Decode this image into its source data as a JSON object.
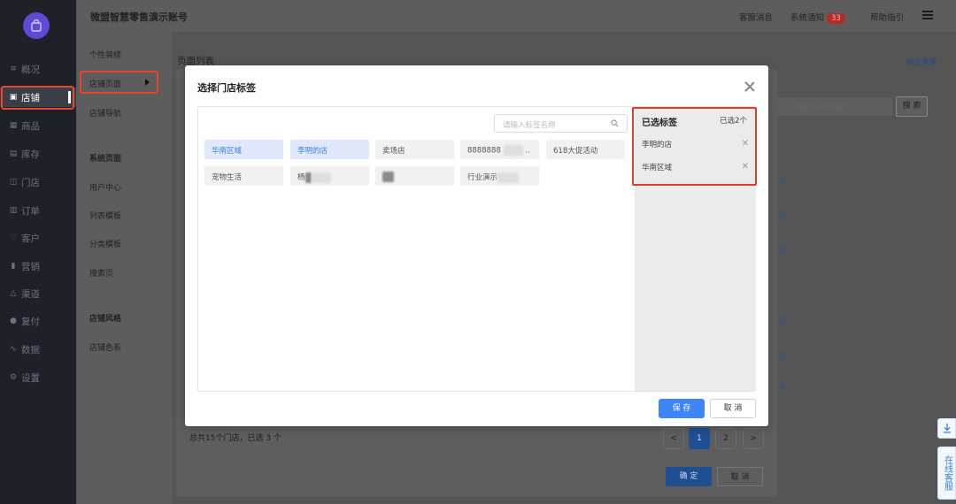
{
  "header": {
    "title": "微盟智慧零售演示账号",
    "links": [
      "客服消息",
      "系统通知",
      "帮助指引"
    ],
    "notification_badge": "33"
  },
  "sidebar": {
    "items": [
      {
        "label": "概况",
        "icon": "overview-icon"
      },
      {
        "label": "店铺",
        "icon": "store-icon",
        "active": true
      },
      {
        "label": "商品",
        "icon": "goods-icon"
      },
      {
        "label": "库存",
        "icon": "inventory-icon"
      },
      {
        "label": "门店",
        "icon": "shop-icon"
      },
      {
        "label": "订单",
        "icon": "order-icon"
      },
      {
        "label": "客户",
        "icon": "customer-icon"
      },
      {
        "label": "营销",
        "icon": "marketing-icon"
      },
      {
        "label": "渠道",
        "icon": "channel-icon"
      },
      {
        "label": "复付",
        "icon": "payment-icon"
      },
      {
        "label": "数据",
        "icon": "data-icon"
      },
      {
        "label": "设置",
        "icon": "settings-icon"
      }
    ]
  },
  "submenu": {
    "items": [
      {
        "label": "个性装修",
        "group": false
      },
      {
        "label": "店铺页面",
        "group": false,
        "active": true
      },
      {
        "label": "店铺导航",
        "group": false
      },
      {
        "label": "系统页面",
        "group": true
      },
      {
        "label": "用户中心",
        "group": false
      },
      {
        "label": "列表模板",
        "group": false
      },
      {
        "label": "分类模板",
        "group": false
      },
      {
        "label": "搜索页",
        "group": false
      },
      {
        "label": "店铺风格",
        "group": true
      },
      {
        "label": "店铺色系",
        "group": false
      }
    ]
  },
  "page": {
    "title": "页面列表",
    "right_link": "标签管理",
    "search_placeholder": "请输入标签名称",
    "search_button": "搜 索",
    "more_link": "多",
    "summary": "总共15个门店，已选 3 个",
    "pagination": [
      "<",
      "1",
      "2",
      ">"
    ],
    "confirm": "确 定",
    "cancel": "取 消"
  },
  "modal": {
    "title": "选择门店标签",
    "search_placeholder": "请输入标签名称",
    "tags": [
      {
        "label": "华南区域",
        "selected": true
      },
      {
        "label": "李明的店",
        "selected": true
      },
      {
        "label": "卖场店",
        "selected": false
      },
      {
        "label": "8888888",
        "suffix": "..",
        "selected": false
      },
      {
        "label": "618大促活动",
        "selected": false
      },
      {
        "label": "宠物生活",
        "selected": false
      },
      {
        "label": "杨",
        "selected": false
      },
      {
        "label": "",
        "selected": false
      },
      {
        "label": "行业演示",
        "selected": false
      }
    ],
    "selected_panel": {
      "title": "已选标签",
      "count": "已选2个",
      "items": [
        "李明的店",
        "华南区域"
      ]
    },
    "save": "保 存",
    "cancel": "取 消"
  },
  "widgets": {
    "online_service": "在线客服"
  },
  "colors": {
    "accent": "#3e86f5",
    "highlight": "#e23b26",
    "selected_tag_bg": "#dfe9fb",
    "sidebar_bg": "#1e2127"
  }
}
